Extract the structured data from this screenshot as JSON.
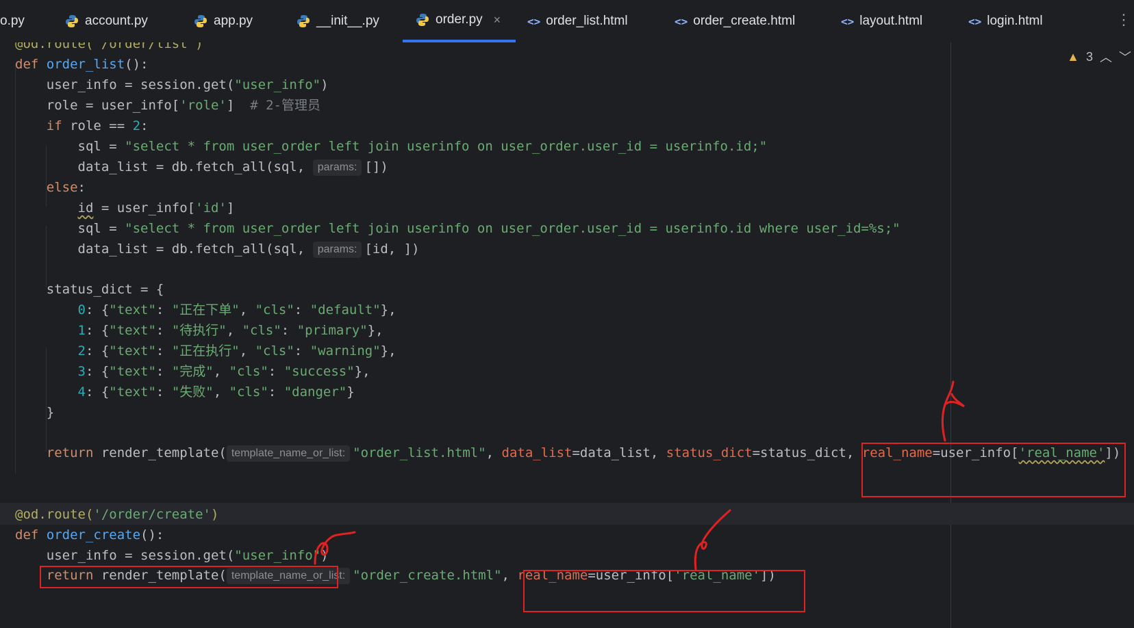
{
  "tabs": [
    {
      "label": "o.py",
      "type": "py"
    },
    {
      "label": "account.py",
      "type": "py"
    },
    {
      "label": "app.py",
      "type": "py"
    },
    {
      "label": "__init__.py",
      "type": "py"
    },
    {
      "label": "order.py",
      "type": "py",
      "active": true
    },
    {
      "label": "order_list.html",
      "type": "html"
    },
    {
      "label": "order_create.html",
      "type": "html"
    },
    {
      "label": "layout.html",
      "type": "html"
    },
    {
      "label": "login.html",
      "type": "html"
    }
  ],
  "tab_close_glyph": "×",
  "more_glyph": "⋮",
  "warnings": {
    "count": "3",
    "icon": "warning-triangle-icon"
  },
  "hints": {
    "params": "params:",
    "template": "template_name_or_list:"
  },
  "code": {
    "l0": "@od.route('/order/list')",
    "l1_def": "def ",
    "l1_fn": "order_list",
    "l1_rest": "():",
    "l2_a": "    user_info = session.get(",
    "l2_s": "\"user_info\"",
    "l2_b": ")",
    "l3_a": "    role = user_info[",
    "l3_s": "'role'",
    "l3_b": "]  ",
    "l3_c": "# 2-管理员",
    "l4_kw": "    if",
    "l4_a": " role == ",
    "l4_n": "2",
    "l4_b": ":",
    "l5_a": "        sql = ",
    "l5_s": "\"select * from user_order left join userinfo on user_order.user_id = userinfo.id;\"",
    "l6_a": "        data_list = db.fetch_all(sql, ",
    "l6_b": "[])",
    "l7_kw": "    else",
    "l7_b": ":",
    "l8_pre": "        ",
    "l8_id": "id",
    "l8_a": " = user_info[",
    "l8_s": "'id'",
    "l8_b": "]",
    "l9_a": "        sql = ",
    "l9_s": "\"select * from user_order left join userinfo on user_order.user_id = userinfo.id where user_id=%s;\"",
    "l10_a": "        data_list = db.fetch_all(sql, ",
    "l10_b": "[id, ])",
    "l12": "    status_dict = {",
    "s0_n": "        0",
    "s0_a": ": {",
    "s0_k1": "\"text\"",
    "s0_v1": "\"正在下单\"",
    "s0_k2": "\"cls\"",
    "s0_v2": "\"default\"",
    "s1_n": "        1",
    "s1_v1": "\"待执行\"",
    "s1_v2": "\"primary\"",
    "s2_n": "        2",
    "s2_v1": "\"正在执行\"",
    "s2_v2": "\"warning\"",
    "s3_n": "        3",
    "s3_v1": "\"完成\"",
    "s3_v2": "\"success\"",
    "s4_n": "        4",
    "s4_v1": "\"失败\"",
    "s4_v2": "\"danger\"",
    "close_brace": "    }",
    "r_kw": "    return",
    "r_a": " render_template(",
    "r_s": "\"order_list.html\"",
    "r_p1": "data_list",
    "r_v1": "=data_list, ",
    "r_p2": "status_dict",
    "r_v2": "=status_dict, ",
    "r_p3": "real_name",
    "r_v3": "=user_info[",
    "r_s3": "'real_name'",
    "r_end": "])",
    "c_dec": "@od.route(",
    "c_dec_s": "'/order/create'",
    "c_dec_e": ")",
    "c_def": "def ",
    "c_fn": "order_create",
    "c_rest": "():",
    "c_l2_a": "    user_info = session.get(",
    "c_l2_s": "\"user_info\"",
    "c_l2_b": ")",
    "c_r_kw": "    return",
    "c_r_a": " render_template(",
    "c_r_s": "\"order_create.html\"",
    "c_r_comma": ", ",
    "c_r_p": "real_name",
    "c_r_v": "=user_info[",
    "c_r_s2": "'real_name'",
    "c_r_end": "])"
  },
  "colors": {
    "keyword": "#cf8e6d",
    "function": "#56a8f5",
    "string": "#6aab73",
    "number": "#2aacb8",
    "annotation": "#e02222",
    "accent": "#3574f0"
  }
}
